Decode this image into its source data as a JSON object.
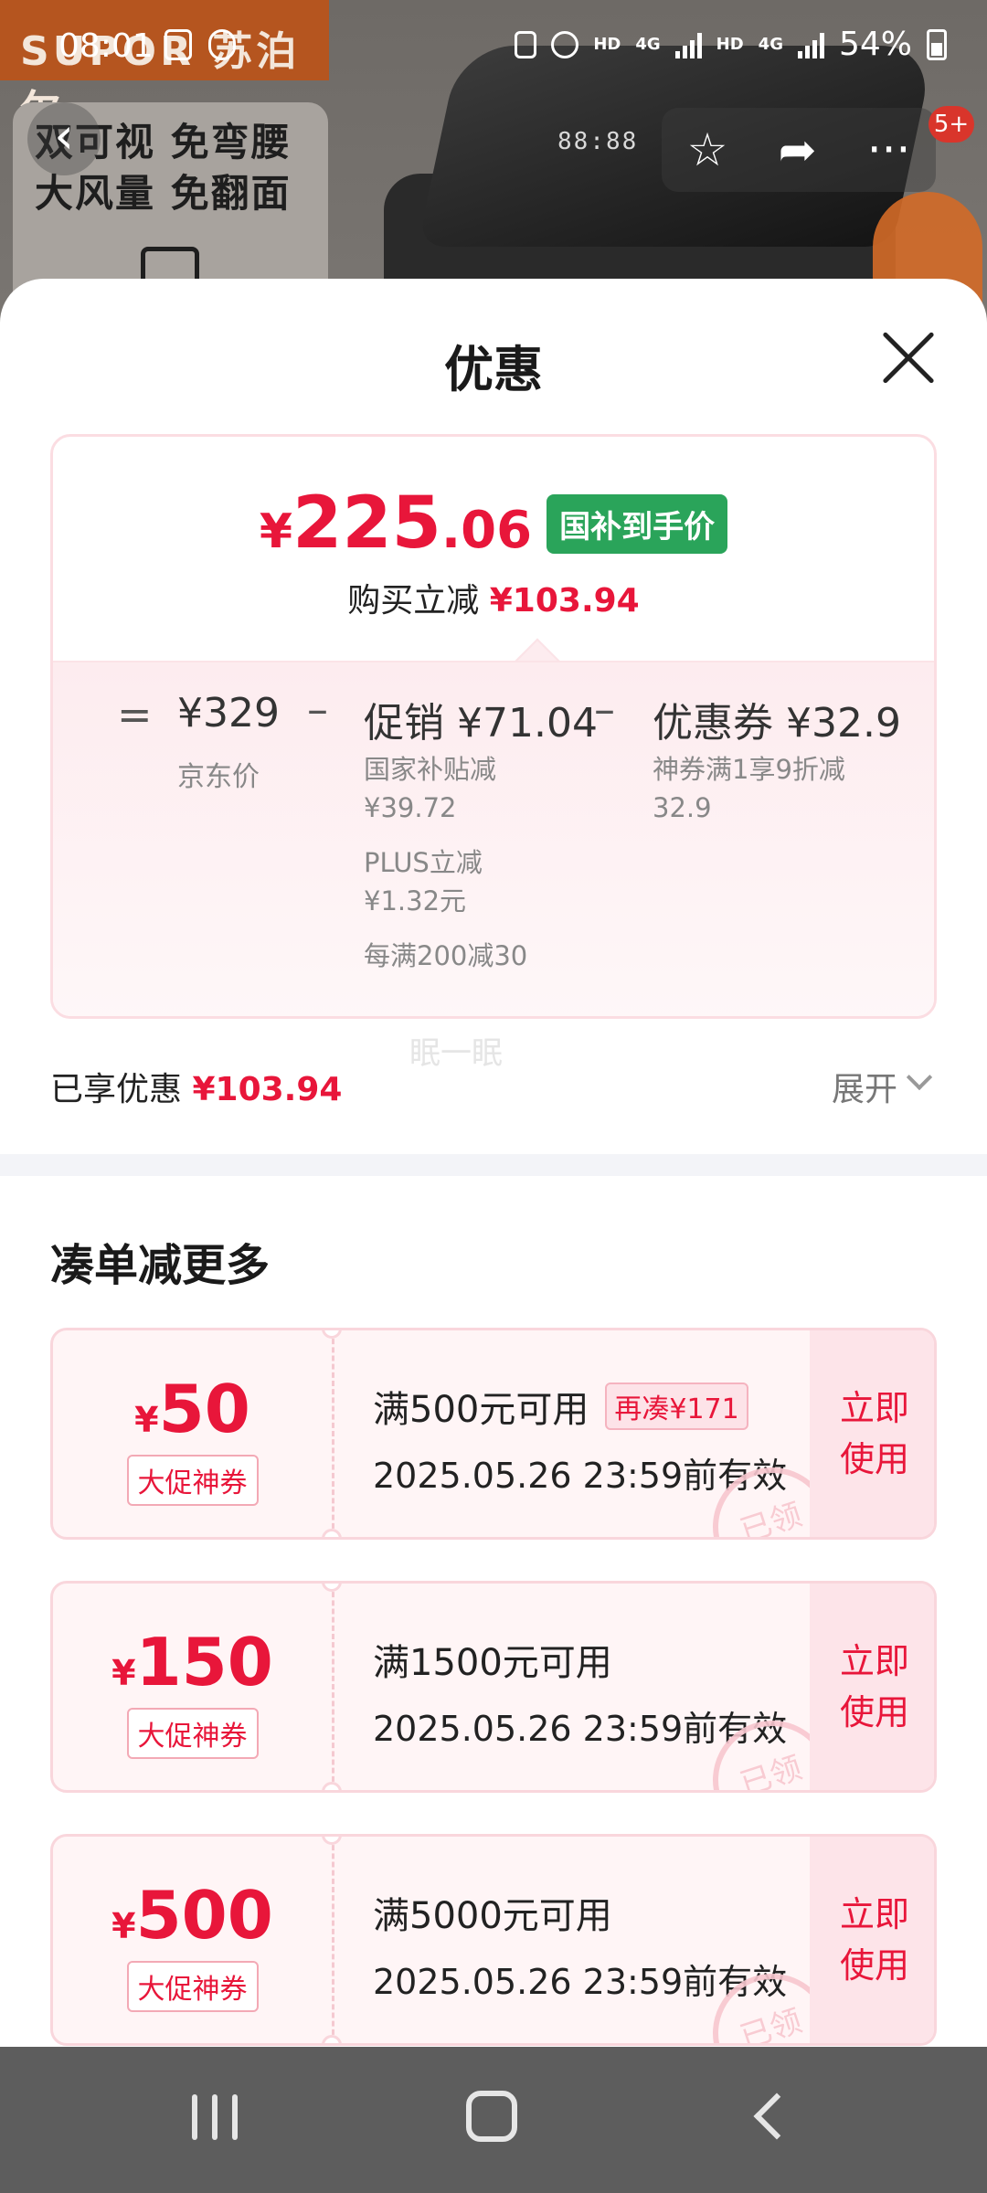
{
  "status_bar": {
    "time": "08:01",
    "battery": "54%",
    "hd1": "HD",
    "net1": "4G",
    "hd2": "HD",
    "net2": "4G"
  },
  "background": {
    "brand": "SUPOR 苏泊尔",
    "promo_line1": "双可视 免弯腰",
    "promo_line2": "大风量 免翻面",
    "panel_display": "88:88",
    "notification_badge": "5+"
  },
  "sheet": {
    "title": "优惠",
    "final_price": {
      "currency": "¥",
      "integer": "225",
      "decimal": ".06"
    },
    "gov_tag": "国补到手价",
    "reduce_label": "购买立减",
    "reduce_amount": "¥103.94",
    "breakdown": {
      "eq": "=",
      "jd_price": "¥329",
      "jd_label": "京东价",
      "minus1": "–",
      "promo_title": "促销 ¥71.04",
      "promo_items": [
        "国家补贴减",
        "¥39.72",
        "PLUS立减",
        "¥1.32元",
        "每满200减30"
      ],
      "minus2": "–",
      "coupon_title": "优惠券 ¥32.9",
      "coupon_items": [
        "神券满1享9折减",
        "32.9"
      ]
    },
    "enjoyed_label": "已享优惠",
    "enjoyed_amount": "¥103.94",
    "watermark": "眠一眠",
    "expand_label": "展开",
    "section_title": "凑单减更多",
    "coupons": [
      {
        "currency": "¥",
        "value": "50",
        "tag": "大促神券",
        "condition": "满500元可用",
        "more": "再凑¥171",
        "valid": "2025.05.26 23:59前有效",
        "stamp": "已领",
        "use_line1": "立即",
        "use_line2": "使用"
      },
      {
        "currency": "¥",
        "value": "150",
        "tag": "大促神券",
        "condition": "满1500元可用",
        "more": "",
        "valid": "2025.05.26 23:59前有效",
        "stamp": "已领",
        "use_line1": "立即",
        "use_line2": "使用"
      },
      {
        "currency": "¥",
        "value": "500",
        "tag": "大促神券",
        "condition": "满5000元可用",
        "more": "",
        "valid": "2025.05.26 23:59前有效",
        "stamp": "已领",
        "use_line1": "立即",
        "use_line2": "使用"
      }
    ]
  },
  "colors": {
    "accent_red": "#e8163a",
    "gov_green": "#2aa45a"
  }
}
